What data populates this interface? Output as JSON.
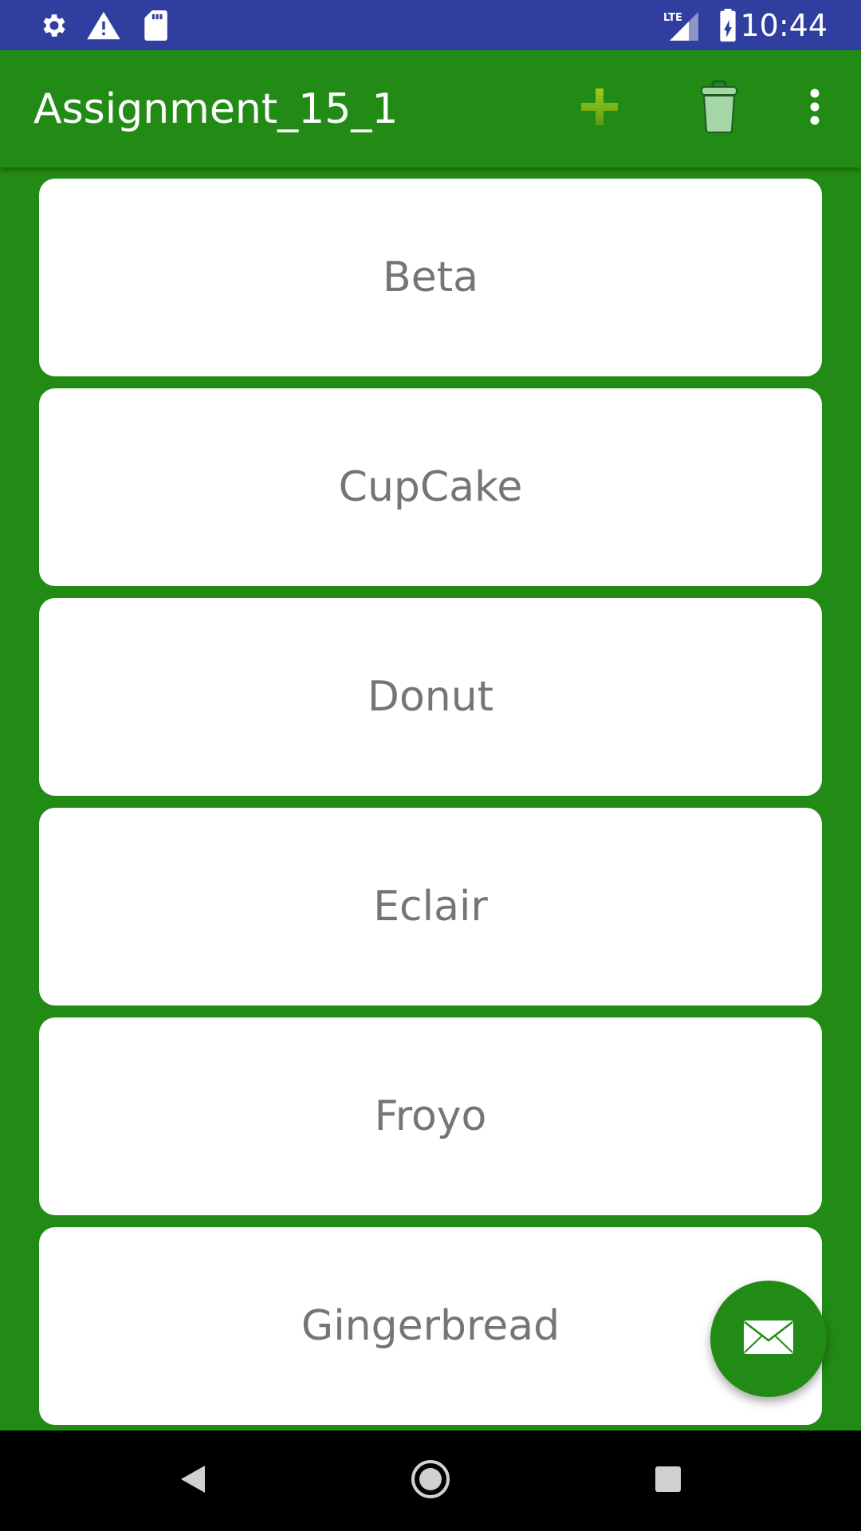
{
  "status_bar": {
    "time": "10:44",
    "network_label": "LTE",
    "icons": [
      "settings-icon",
      "warning-icon",
      "sd-card-icon",
      "signal-icon",
      "battery-charging-icon"
    ]
  },
  "app_bar": {
    "title": "Assignment_15_1",
    "actions": [
      "add-icon",
      "trash-icon",
      "overflow-menu-icon"
    ]
  },
  "list": {
    "items": [
      {
        "label": "Beta"
      },
      {
        "label": "CupCake"
      },
      {
        "label": "Donut"
      },
      {
        "label": "Eclair"
      },
      {
        "label": "Froyo"
      },
      {
        "label": "Gingerbread"
      }
    ]
  },
  "fab": {
    "icon": "mail-icon"
  },
  "nav_bar": {
    "buttons": [
      "back-icon",
      "home-icon",
      "recents-icon"
    ]
  },
  "colors": {
    "status_bar": "#303F9F",
    "primary": "#228B15",
    "card": "#FFFFFF",
    "item_text": "#757575",
    "add_icon": "#7CB518",
    "trash_icon": "#A5D6A7"
  }
}
